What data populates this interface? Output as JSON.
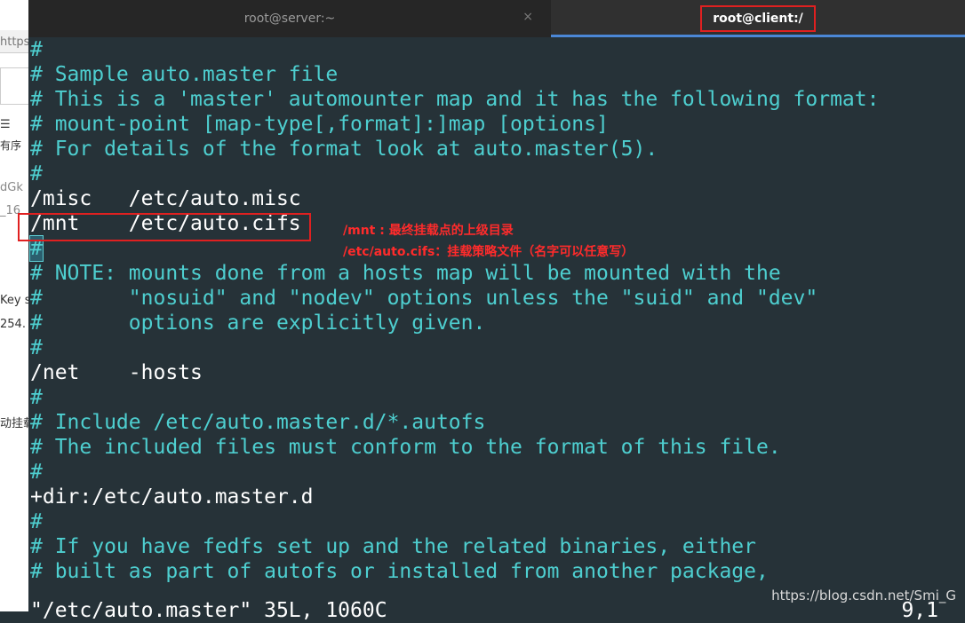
{
  "background_window": {
    "url_fragment": "https:",
    "texts": [
      "有序",
      "dGk",
      "_16",
      "Key s",
      "254.",
      "动挂载"
    ]
  },
  "tabs": [
    {
      "title": "root@server:~",
      "active": false
    },
    {
      "title": "root@client:/",
      "active": true
    }
  ],
  "close_glyph": "×",
  "lines": [
    "#",
    "# Sample auto.master file",
    "# This is a 'master' automounter map and it has the following format:",
    "# mount-point [map-type[,format]:]map [options]",
    "# For details of the format look at auto.master(5).",
    "#",
    "/misc   /etc/auto.misc",
    "/mnt    /etc/auto.cifs",
    "#",
    "# NOTE: mounts done from a hosts map will be mounted with the",
    "#       \"nosuid\" and \"nodev\" options unless the \"suid\" and \"dev\"",
    "#       options are explicitly given.",
    "#",
    "/net    -hosts",
    "#",
    "# Include /etc/auto.master.d/*.autofs",
    "# The included files must conform to the format of this file.",
    "#",
    "+dir:/etc/auto.master.d",
    "#",
    "# If you have fedfs set up and the related binaries, either",
    "# built as part of autofs or installed from another package,"
  ],
  "annotations": [
    "/mnt : 最终挂载点的上级目录",
    "/etc/auto.cifs：挂载策略文件（名字可以任意写）"
  ],
  "status_line": "\"/etc/auto.master\" 35L, 1060C",
  "cursor_position": "9,1",
  "watermark": "https://blog.csdn.net/Smi_G"
}
